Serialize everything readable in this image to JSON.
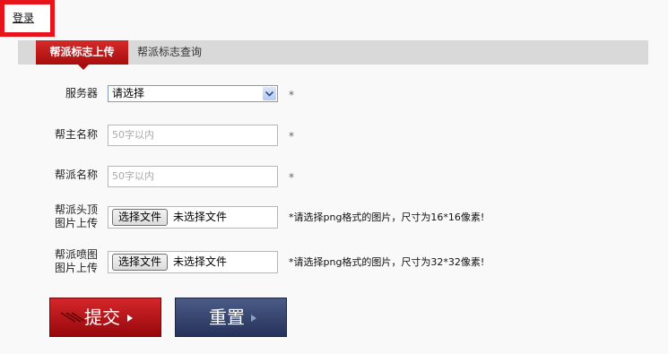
{
  "header": {
    "login_link": "登录"
  },
  "tabs": [
    {
      "label": "帮派标志上传",
      "active": true
    },
    {
      "label": "帮派标志查询",
      "active": false
    }
  ],
  "form": {
    "server": {
      "label": "服务器",
      "selected": "请选择",
      "required_mark": "*"
    },
    "leader_name": {
      "label": "帮主名称",
      "placeholder": "50字以内",
      "required_mark": "*"
    },
    "guild_name": {
      "label": "帮派名称",
      "placeholder": "50字以内",
      "required_mark": "*"
    },
    "head_image": {
      "label_line1": "帮派头顶",
      "label_line2": "图片上传",
      "button": "选择文件",
      "status": "未选择文件",
      "hint": "*请选择png格式的图片，尺寸为16*16像素!"
    },
    "spray_image": {
      "label_line1": "帮派喷图",
      "label_line2": "图片上传",
      "button": "选择文件",
      "status": "未选择文件",
      "hint": "*请选择png格式的图片，尺寸为32*32像素!"
    }
  },
  "actions": {
    "submit": "提交",
    "reset": "重置"
  },
  "colors": {
    "highlight_border": "#e8141c",
    "tab_active": "#c01b1b",
    "tabbar_bg": "#d9d9d9",
    "submit_bg": "#b71417",
    "reset_bg": "#37446d"
  }
}
